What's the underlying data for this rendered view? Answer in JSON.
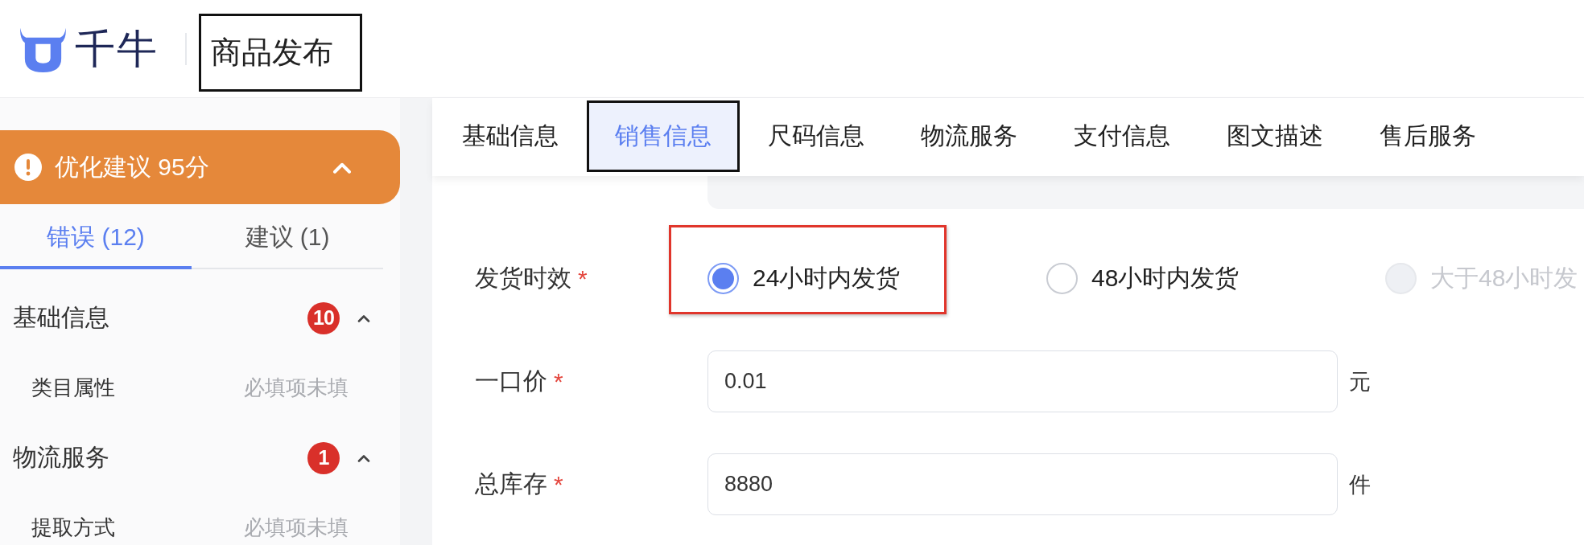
{
  "header": {
    "app_name": "千牛",
    "page_title": {
      "text": "商品发布",
      "boxed": true
    }
  },
  "sidebar": {
    "banner": {
      "text": "优化建议 95分",
      "expanded": true
    },
    "tabs": [
      {
        "label": "错误 (12)",
        "selected": true
      },
      {
        "label": "建议 (1)",
        "selected": false
      }
    ],
    "sections": [
      {
        "title": "基础信息",
        "count": "10",
        "expanded": true,
        "children": [
          {
            "label": "类目属性",
            "status": "必填项未填"
          }
        ]
      },
      {
        "title": "物流服务",
        "count": "1",
        "expanded": true,
        "children": [
          {
            "label": "提取方式",
            "status": "必填项未填"
          }
        ]
      }
    ]
  },
  "tabs": [
    {
      "label": "基础信息",
      "selected": false,
      "boxed": false
    },
    {
      "label": "销售信息",
      "selected": true,
      "boxed": true
    },
    {
      "label": "尺码信息",
      "selected": false,
      "boxed": false
    },
    {
      "label": "物流服务",
      "selected": false,
      "boxed": false
    },
    {
      "label": "支付信息",
      "selected": false,
      "boxed": false
    },
    {
      "label": "图文描述",
      "selected": false,
      "boxed": false
    },
    {
      "label": "售后服务",
      "selected": false,
      "boxed": false
    }
  ],
  "form": {
    "fields": [
      {
        "kind": "radio",
        "label": "发货时效",
        "required_mark": "*",
        "options": [
          {
            "label": "24小时内发货",
            "selected": true,
            "disabled": false,
            "boxed": true
          },
          {
            "label": "48小时内发货",
            "selected": false,
            "disabled": false,
            "boxed": false
          },
          {
            "label": "大于48小时发",
            "selected": false,
            "disabled": true,
            "boxed": false
          }
        ]
      },
      {
        "kind": "input",
        "label": "一口价",
        "required_mark": "*",
        "value": "0.01",
        "unit": "元"
      },
      {
        "kind": "input",
        "label": "总库存",
        "required_mark": "*",
        "value": "8880",
        "unit": "件"
      }
    ]
  }
}
